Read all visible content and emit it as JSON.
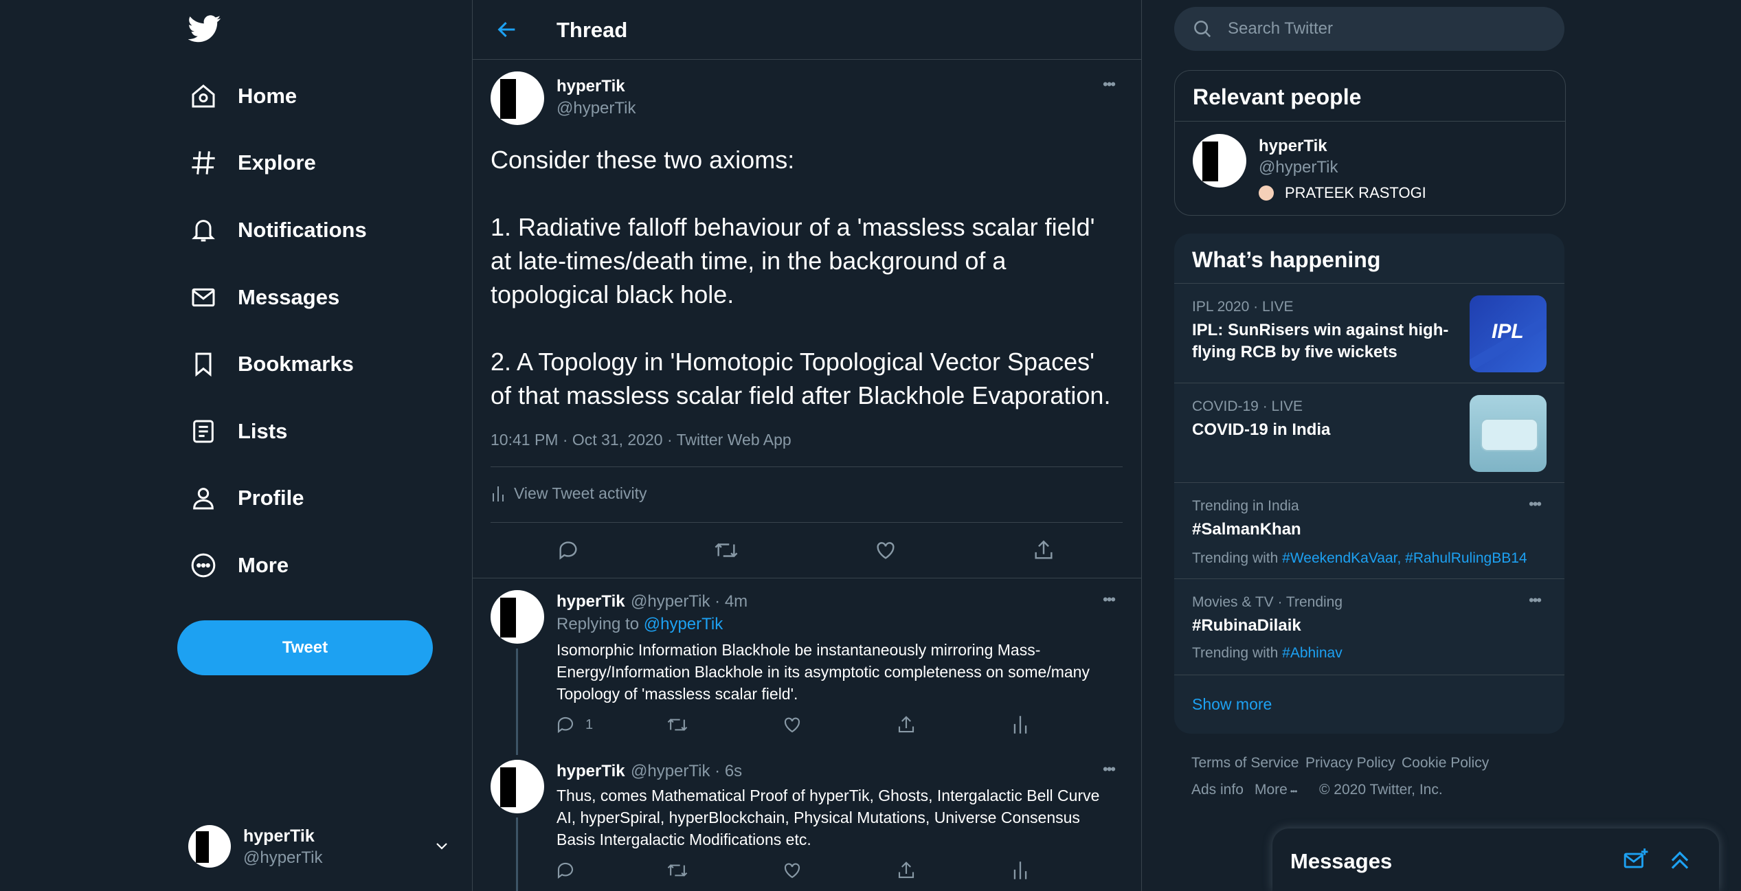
{
  "nav": {
    "items": [
      {
        "label": "Home",
        "icon": "home-icon"
      },
      {
        "label": "Explore",
        "icon": "hashtag-icon"
      },
      {
        "label": "Notifications",
        "icon": "bell-icon"
      },
      {
        "label": "Messages",
        "icon": "envelope-icon"
      },
      {
        "label": "Bookmarks",
        "icon": "bookmark-icon"
      },
      {
        "label": "Lists",
        "icon": "list-icon"
      },
      {
        "label": "Profile",
        "icon": "person-icon"
      },
      {
        "label": "More",
        "icon": "more-circle-icon"
      }
    ],
    "tweet_button": "Tweet",
    "account": {
      "name": "hyperTik",
      "handle": "@hyperTik"
    }
  },
  "header": {
    "title": "Thread"
  },
  "main_tweet": {
    "name": "hyperTik",
    "handle": "@hyperTik",
    "lines": [
      "Consider these two axioms:",
      "1. Radiative falloff behaviour of a 'massless scalar field'",
      "at late-times/death time, in the background of a",
      "topological black hole.",
      "2. A Topology in 'Homotopic Topological Vector Spaces'",
      "of that massless scalar field after Blackhole Evaporation."
    ],
    "meta": "10:41 PM · Oct 31, 2020 · Twitter Web App",
    "activity": "View Tweet activity"
  },
  "replies": [
    {
      "name": "hyperTik",
      "meta": "@hyperTik · 4m",
      "replying_prefix": "Replying to",
      "replying_to": "@hyperTik",
      "lines": [
        "Isomorphic Information Blackhole be instantaneously mirroring Mass-",
        "Energy/Information Blackhole in its asymptotic completeness on some/many",
        "Topology of 'massless scalar field'."
      ],
      "reply_count": "1"
    },
    {
      "name": "hyperTik",
      "meta": "@hyperTik · 6s",
      "lines": [
        "Thus, comes Mathematical Proof of hyperTik, Ghosts, Intergalactic Bell Curve",
        "AI, hyperSpiral, hyperBlockchain, Physical Mutations, Universe Consensus",
        "Basis Intergalactic Modifications etc."
      ]
    }
  ],
  "search": {
    "placeholder": "Search Twitter"
  },
  "relevant": {
    "title": "Relevant people",
    "name": "hyperTik",
    "handle": "@hyperTik",
    "bio": "PRATEEK RASTOGI"
  },
  "happening": {
    "title": "What’s happening",
    "trends": [
      {
        "category": "IPL 2020 · LIVE",
        "title_lines": [
          "IPL: SunRisers win against high-",
          "flying RCB by five wickets"
        ]
      },
      {
        "category": "COVID-19 · LIVE",
        "title_lines": [
          "COVID-19 in India"
        ]
      },
      {
        "category": "Trending in India",
        "title_lines": [
          "#SalmanKhan"
        ],
        "with_prefix": "Trending with",
        "with_tags": "#WeekendKaVaar, #RahulRulingBB14"
      },
      {
        "category": "Movies & TV · Trending",
        "title_lines": [
          "#RubinaDilaik"
        ],
        "with_prefix": "Trending with",
        "with_tags": "#Abhinav"
      }
    ],
    "show_more": "Show more",
    "ipl_logo_text": "IPL"
  },
  "footer": {
    "terms": "Terms of Service",
    "privacy": "Privacy Policy",
    "cookie": "Cookie Policy",
    "ads": "Ads info",
    "more": "More",
    "copyright": "© 2020 Twitter, Inc."
  },
  "messages_drawer": {
    "title": "Messages"
  },
  "colors": {
    "background": "#15202b",
    "accent": "#1da1f2",
    "muted": "#8899a6",
    "border": "#38444d",
    "panel": "#192734"
  }
}
